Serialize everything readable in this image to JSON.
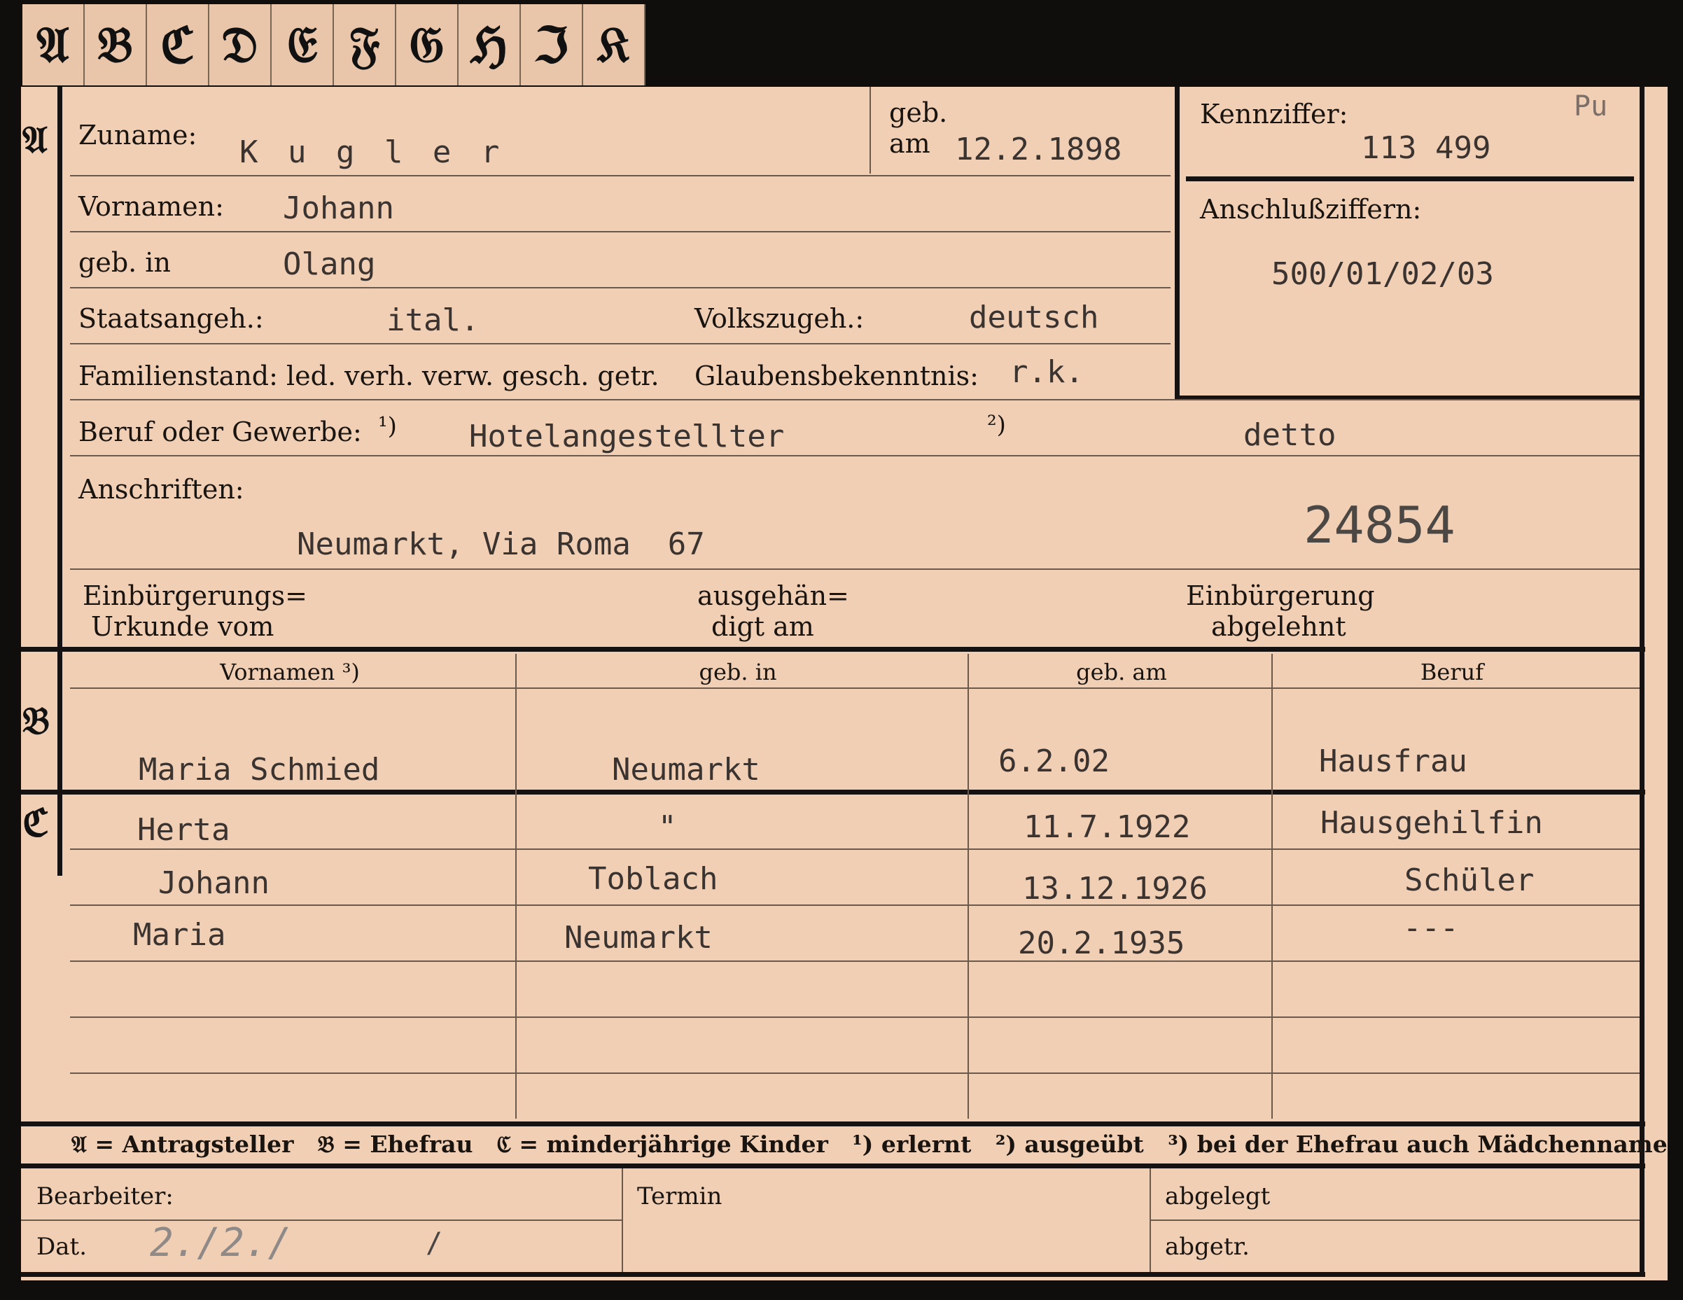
{
  "tabs": [
    "𝔄",
    "𝔅",
    "ℭ",
    "𝔇",
    "𝔈",
    "𝔉",
    "𝔊",
    "ℌ",
    "ℑ",
    "𝔎"
  ],
  "sections": {
    "a": "𝔄",
    "b": "𝔅",
    "c": "ℭ"
  },
  "applicant": {
    "surname_label": "Zuname:",
    "surname": "K u g l e r",
    "born_on_label1": "geb.",
    "born_on_label2": "am",
    "born_on": "12.2.1898",
    "firstnames_label": "Vornamen:",
    "firstnames": "Johann",
    "birthplace_label": "geb. in",
    "birthplace": "Olang",
    "citizenship_label": "Staatsangeh.:",
    "citizenship": "ital.",
    "ethnicity_label": "Volkszugeh.:",
    "ethnicity": "deutsch",
    "marital_label": "Familienstand: led. verh. verw. gesch. getr.",
    "religion_label": "Glaubensbekenntnis:",
    "religion": "r.k.",
    "occupation_label": "Beruf oder Gewerbe:",
    "occ_mark1": "¹)",
    "occupation_learned": "Hotelangestellter",
    "occ_mark2": "²)",
    "occupation_practiced": "detto",
    "address_label": "Anschriften:",
    "address": "Neumarkt, Via Roma  67",
    "stamp_number": "24854",
    "naturalization_doc_label1": "Einbürgerungs=",
    "naturalization_doc_label2": "Urkunde vom",
    "issued_label1": "ausgehän=",
    "issued_label2": "digt am",
    "refused_label1": "Einbürgerung",
    "refused_label2": "abgelehnt"
  },
  "id_box": {
    "label": "Kennziffer:",
    "corner_note": "Pu",
    "number": "113 499",
    "connect_label": "Anschlußziffern:",
    "connect_numbers": "500/01/02/03"
  },
  "family_headers": {
    "firstnames": "Vornamen ³)",
    "birthplace": "geb. in",
    "born_on": "geb. am",
    "occupation": "Beruf"
  },
  "spouse": {
    "firstnames": "Maria Schmied",
    "birthplace": "Neumarkt",
    "born_on": "6.2.02",
    "occupation": "Hausfrau"
  },
  "children": [
    {
      "firstnames": "Herta",
      "birthplace": "\"",
      "born_on": "11.7.1922",
      "occupation": "Hausgehilfin"
    },
    {
      "firstnames": "Johann",
      "birthplace": "Toblach",
      "born_on": "13.12.1926",
      "occupation": "Schüler"
    },
    {
      "firstnames": "Maria",
      "birthplace": "Neumarkt",
      "born_on": "20.2.1935",
      "occupation": "---"
    }
  ],
  "legend": "𝔄 = Antragsteller   𝔅 = Ehefrau   ℭ = minderjährige Kinder   ¹) erlernt   ²) ausgeübt   ³) bei der Ehefrau auch Mädchenname",
  "footer": {
    "editor_label": "Bearbeiter:",
    "date_label": "Dat.",
    "date_value": "2./2./",
    "date_slash": "/",
    "deadline_label": "Termin",
    "filed_label": "abgelegt",
    "separated_label": "abgetr."
  }
}
